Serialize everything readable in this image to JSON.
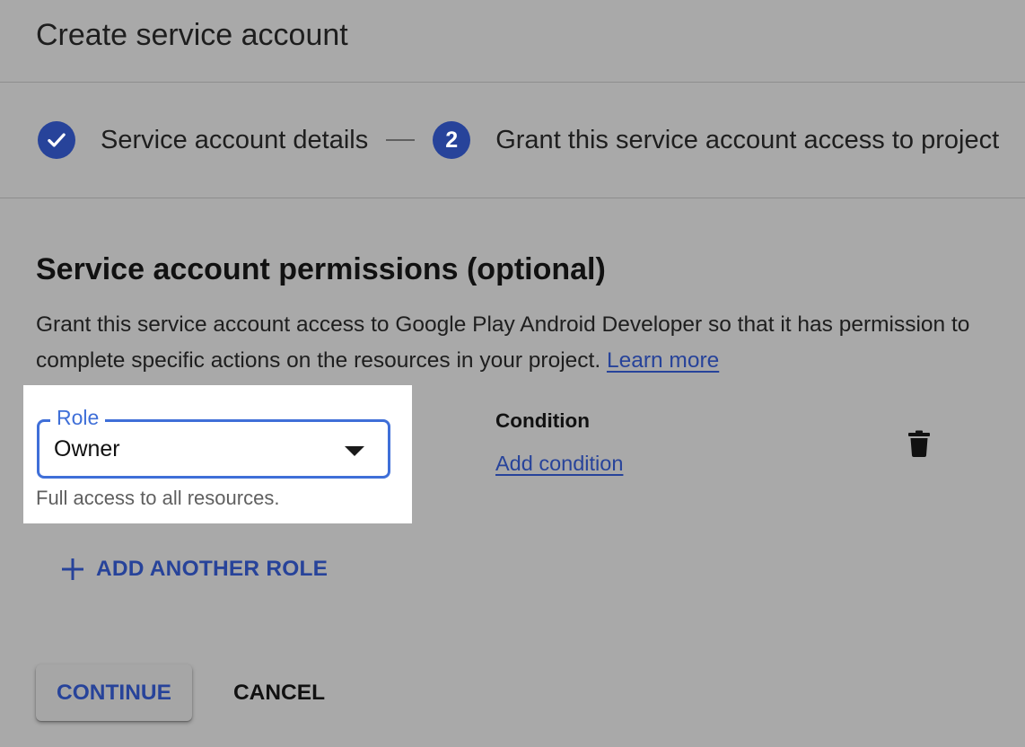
{
  "header": {
    "title": "Create service account"
  },
  "stepper": {
    "steps": [
      {
        "label": "Service account details",
        "state": "completed",
        "icon": "check-icon"
      },
      {
        "label": "Grant this service account access to project",
        "state": "active",
        "number": "2"
      }
    ]
  },
  "permissions": {
    "title": "Service account permissions (optional)",
    "description": "Grant this service account access to Google Play Android Developer so that it has permission to complete specific actions on the resources in your project.",
    "learn_more": "Learn more"
  },
  "role_field": {
    "label": "Role",
    "value": "Owner",
    "helper": "Full access to all resources."
  },
  "condition": {
    "heading": "Condition",
    "add_link": "Add condition",
    "delete_icon": "trash-icon"
  },
  "add_role": {
    "label": "ADD ANOTHER ROLE",
    "icon": "plus-icon"
  },
  "actions": {
    "continue_label": "CONTINUE",
    "cancel_label": "CANCEL"
  },
  "colors": {
    "accent": "#27439a",
    "focus": "#3f6fd8",
    "overlay_background": "#a9a9a9"
  }
}
